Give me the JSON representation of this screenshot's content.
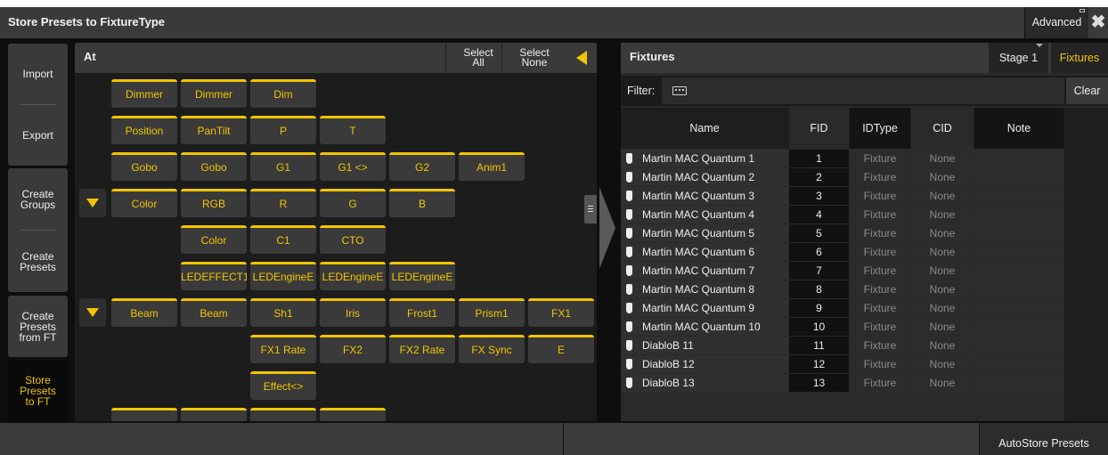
{
  "window": {
    "title": "Store Presets to FixtureType",
    "advanced_label": "Advanced",
    "close_glyph": "✖"
  },
  "left_menu": {
    "items": [
      {
        "label": "Import"
      },
      {
        "label": "Export"
      },
      {
        "label": "Create\nGroups"
      },
      {
        "label": "Create\nPresets"
      },
      {
        "label": "Create\nPresets\nfrom FT"
      },
      {
        "label": "Store\nPresets\nto FT",
        "active": true
      }
    ]
  },
  "at_panel": {
    "title": "At",
    "select_all": "Select\nAll",
    "select_none": "Select\nNone",
    "rows": [
      [
        "Dimmer",
        "Dimmer",
        "Dim"
      ],
      [
        "Position",
        "PanTilt",
        "P",
        "T"
      ],
      [
        "Gobo",
        "Gobo",
        "G1",
        "G1 <>",
        "G2",
        "Anim1"
      ],
      [
        "Color",
        "RGB",
        "R",
        "G",
        "B"
      ],
      [
        "",
        "Color",
        "C1",
        "CTO"
      ],
      [
        "",
        "LEDEFFECT1",
        "LEDEngineE",
        "LEDEngineE",
        "LEDEngineE"
      ],
      [
        "Beam",
        "Beam",
        "Sh1",
        "Iris",
        "Frost1",
        "Prism1",
        "FX1"
      ],
      [
        "",
        "",
        "FX1 Rate",
        "FX2",
        "FX2 Rate",
        "FX Sync",
        "E"
      ],
      [
        "",
        "",
        "Effect<>"
      ]
    ]
  },
  "fixtures_panel": {
    "title": "Fixtures",
    "stage_label": "Stage 1",
    "fixtures_tab": "Fixtures",
    "filter_label": "Filter:",
    "clear_label": "Clear",
    "columns": [
      "Name",
      "FID",
      "IDType",
      "CID",
      "Note"
    ],
    "rows": [
      {
        "name": "Martin MAC Quantum 1",
        "fid": "1",
        "idtype": "Fixture",
        "cid": "None"
      },
      {
        "name": "Martin MAC Quantum 2",
        "fid": "2",
        "idtype": "Fixture",
        "cid": "None"
      },
      {
        "name": "Martin MAC Quantum 3",
        "fid": "3",
        "idtype": "Fixture",
        "cid": "None"
      },
      {
        "name": "Martin MAC Quantum 4",
        "fid": "4",
        "idtype": "Fixture",
        "cid": "None"
      },
      {
        "name": "Martin MAC Quantum 5",
        "fid": "5",
        "idtype": "Fixture",
        "cid": "None"
      },
      {
        "name": "Martin MAC Quantum 6",
        "fid": "6",
        "idtype": "Fixture",
        "cid": "None"
      },
      {
        "name": "Martin MAC Quantum 7",
        "fid": "7",
        "idtype": "Fixture",
        "cid": "None"
      },
      {
        "name": "Martin MAC Quantum 8",
        "fid": "8",
        "idtype": "Fixture",
        "cid": "None"
      },
      {
        "name": "Martin MAC Quantum 9",
        "fid": "9",
        "idtype": "Fixture",
        "cid": "None"
      },
      {
        "name": "Martin MAC Quantum 10",
        "fid": "10",
        "idtype": "Fixture",
        "cid": "None"
      },
      {
        "name": "DiabloB 11",
        "fid": "11",
        "idtype": "Fixture",
        "cid": "None"
      },
      {
        "name": "DiabloB 12",
        "fid": "12",
        "idtype": "Fixture",
        "cid": "None"
      },
      {
        "name": "DiabloB 13",
        "fid": "13",
        "idtype": "Fixture",
        "cid": "None"
      }
    ]
  },
  "bottom_bar": {
    "autostore_label": "AutoStore Presets"
  },
  "colors": {
    "accent": "#f1c400",
    "panel": "#3a3a3a",
    "background": "#0e0e0e"
  }
}
